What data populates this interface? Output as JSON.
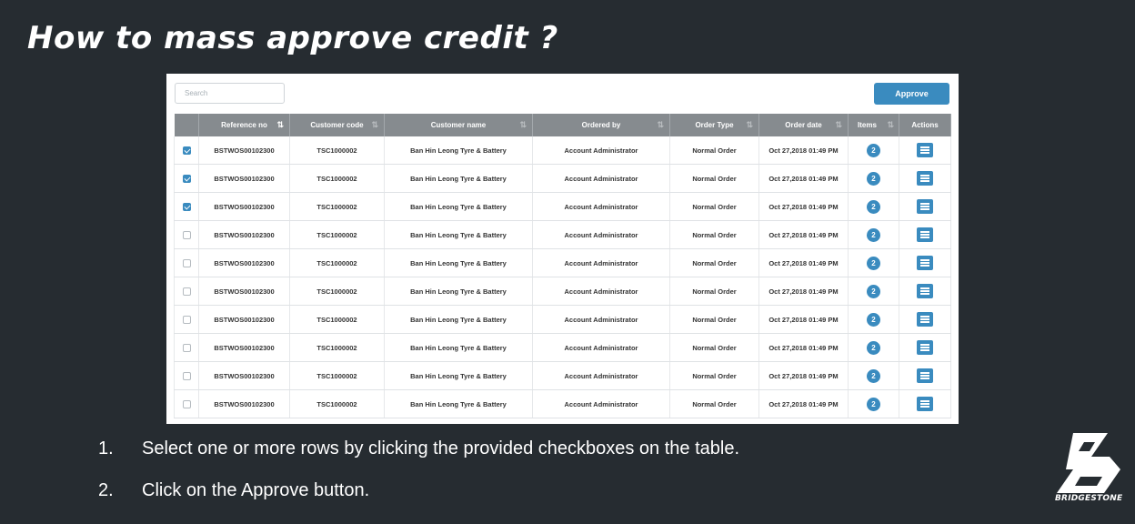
{
  "slide": {
    "title": "How to mass approve credit ?",
    "instructions": [
      {
        "number": "1.",
        "text": "Select one or more rows by clicking the provided checkboxes on the table."
      },
      {
        "number": "2.",
        "text": "Click on the Approve button."
      }
    ],
    "logo_text": "BRIDGESTONE"
  },
  "toolbar": {
    "search_placeholder": "Search",
    "approve_label": "Approve"
  },
  "table": {
    "columns": [
      "",
      "Reference no",
      "Customer code",
      "Customer name",
      "Ordered by",
      "Order Type",
      "Order date",
      "Items",
      "Actions"
    ],
    "rows": [
      {
        "checked": true,
        "reference": "BSTWOS00102300",
        "customer_code": "TSC1000002",
        "customer_name": "Ban Hin Leong Tyre & Battery",
        "ordered_by": "Account Administrator",
        "order_type": "Normal Order",
        "order_date": "Oct 27,2018 01:49 PM",
        "items": "2"
      },
      {
        "checked": true,
        "reference": "BSTWOS00102300",
        "customer_code": "TSC1000002",
        "customer_name": "Ban Hin Leong Tyre & Battery",
        "ordered_by": "Account Administrator",
        "order_type": "Normal Order",
        "order_date": "Oct 27,2018 01:49 PM",
        "items": "2"
      },
      {
        "checked": true,
        "reference": "BSTWOS00102300",
        "customer_code": "TSC1000002",
        "customer_name": "Ban Hin Leong Tyre & Battery",
        "ordered_by": "Account Administrator",
        "order_type": "Normal Order",
        "order_date": "Oct 27,2018 01:49 PM",
        "items": "2"
      },
      {
        "checked": false,
        "reference": "BSTWOS00102300",
        "customer_code": "TSC1000002",
        "customer_name": "Ban Hin Leong Tyre & Battery",
        "ordered_by": "Account Administrator",
        "order_type": "Normal Order",
        "order_date": "Oct 27,2018 01:49 PM",
        "items": "2"
      },
      {
        "checked": false,
        "reference": "BSTWOS00102300",
        "customer_code": "TSC1000002",
        "customer_name": "Ban Hin Leong Tyre & Battery",
        "ordered_by": "Account Administrator",
        "order_type": "Normal Order",
        "order_date": "Oct 27,2018 01:49 PM",
        "items": "2"
      },
      {
        "checked": false,
        "reference": "BSTWOS00102300",
        "customer_code": "TSC1000002",
        "customer_name": "Ban Hin Leong Tyre & Battery",
        "ordered_by": "Account Administrator",
        "order_type": "Normal Order",
        "order_date": "Oct 27,2018 01:49 PM",
        "items": "2"
      },
      {
        "checked": false,
        "reference": "BSTWOS00102300",
        "customer_code": "TSC1000002",
        "customer_name": "Ban Hin Leong Tyre & Battery",
        "ordered_by": "Account Administrator",
        "order_type": "Normal Order",
        "order_date": "Oct 27,2018 01:49 PM",
        "items": "2"
      },
      {
        "checked": false,
        "reference": "BSTWOS00102300",
        "customer_code": "TSC1000002",
        "customer_name": "Ban Hin Leong Tyre & Battery",
        "ordered_by": "Account Administrator",
        "order_type": "Normal Order",
        "order_date": "Oct 27,2018 01:49 PM",
        "items": "2"
      },
      {
        "checked": false,
        "reference": "BSTWOS00102300",
        "customer_code": "TSC1000002",
        "customer_name": "Ban Hin Leong Tyre & Battery",
        "ordered_by": "Account Administrator",
        "order_type": "Normal Order",
        "order_date": "Oct 27,2018 01:49 PM",
        "items": "2"
      },
      {
        "checked": false,
        "reference": "BSTWOS00102300",
        "customer_code": "TSC1000002",
        "customer_name": "Ban Hin Leong Tyre & Battery",
        "ordered_by": "Account Administrator",
        "order_type": "Normal Order",
        "order_date": "Oct 27,2018 01:49 PM",
        "items": "2"
      }
    ]
  },
  "icons": {
    "sort": "sort-icon",
    "checkbox": "checkbox-icon",
    "action": "details-icon"
  },
  "colors": {
    "background": "#262c31",
    "accent": "#3a8bbf",
    "header": "#868b8f"
  }
}
